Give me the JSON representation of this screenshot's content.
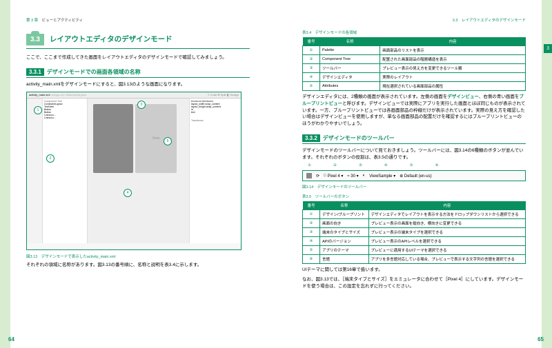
{
  "hdr": {
    "left_ch": "第 3 章",
    "left_t": "ビューとアクティビティ",
    "right": "3.3　レイアウトエディタのデザインモード",
    "tab": "3"
  },
  "sec": {
    "num": "3.3",
    "title": "レイアウトエディタのデザインモード",
    "intro": "ここで、ここまで作成してきた画面をレイアウトエディタのデザインモードで確認してみましょう。"
  },
  "s331": {
    "num": "3.3.1",
    "title": "デザインモードでの画面各領域の名称",
    "p1": "activity_main.xmlをデザインモードにすると、図3.13のような画面になります。",
    "cap": "図3.13　デザインモードで表示したactivity_main.xml",
    "p2": "それぞれの領域に名称があります。図3.13の番号順に、名称と説明を表3.4に示します。"
  },
  "ss": {
    "tabs": [
      "activity_main.xml",
      "strings.xml",
      "MainActivity.java"
    ],
    "tree_h": "Component Tree",
    "tree": [
      "ConstraintLayout",
      "  TextView",
      "  Button",
      "  Button",
      "  LinearLa...",
      "  LinearLa..."
    ],
    "view": "View",
    "attr_h": "Declared Attributes",
    "attr": [
      "layout_width  wrap_content",
      "layout_height  wrap_content",
      "id",
      "text"
    ],
    "trans": "Transforms"
  },
  "t34": {
    "cap": "表3.4　デザインモードの各領域",
    "h": [
      "番号",
      "名称",
      "内容"
    ],
    "r": [
      [
        "①",
        "Palette",
        "画面部品のリストを表示"
      ],
      [
        "②",
        "Component Tree",
        "配置された画面部品の階層構造を表示"
      ],
      [
        "③",
        "ツールバー",
        "プレビュー表示の見え方を変更できるツール類"
      ],
      [
        "④",
        "デザインエディタ",
        "実際のレイアウト"
      ],
      [
        "⑤",
        "Attributes",
        "現在選択されている画面部品の属性"
      ]
    ]
  },
  "rp1": "デザインエディタには、2種類の画面が表示されています。左側の画面を",
  "rp1a": "デザインビュー",
  "rp1b": "、右側の青い画面を",
  "rp1c": "ブループリントビュー",
  "rp1d": "と呼びます。デザインビューでは実際にアプリを実行した画面とほぼ同じものが表示されています。一方、ブループリントビューでは各画面部品の枠線だけが表示されています。実際の見え方を確認したい場合はデザインビューを使用しますが、単なる画面部品の配置だけを確認するにはブループリントビューのほうがわかりやすいでしょう。",
  "s332": {
    "num": "3.3.2",
    "title": "デザインモードのツールバー",
    "p1": "デザインモードのツールバーについて見ておきましょう。ツールバーには、図3.14の6種類のボタンが並んでいます。それぞれのボタンの役割は、表3.5の通りです。",
    "cap": "図3.14　デザインモードのツールバー"
  },
  "tb": {
    "nums": [
      "①",
      "②",
      "③",
      "④",
      "⑤",
      "⑥"
    ],
    "pixel": "Pixel 4 ▾",
    "api": "≈ 30 ▾",
    "theme": "◐",
    "vs": "ViewSample ▾",
    "loc": "⊕ Default (en-us)"
  },
  "t35": {
    "cap": "表3.5　ツールバーのボタン",
    "h": [
      "番号",
      "名称",
      "内容"
    ],
    "r": [
      [
        "①",
        "デザイン/ブループリント",
        "デザインエディタでレイアウトを表示する方法をドロップダウンリストから選択できる"
      ],
      [
        "②",
        "画面の向き",
        "プレビュー表示の画面を縦向き、横向きに変更できる"
      ],
      [
        "③",
        "端末のタイプとサイズ",
        "プレビュー表示の端末タイプを選択できる"
      ],
      [
        "④",
        "APIのバージョン",
        "プレビュー表示のAPIレベルを選択できる"
      ],
      [
        "⑤",
        "アプリのテーマ",
        "プレビューに適用するUIテーマを選択できる"
      ],
      [
        "⑥",
        "言語",
        "アプリを多言語対応している場合、プレビューで表示する文字列の言語を選択できる"
      ]
    ]
  },
  "rp2": "UIテーマに関しては第16章で扱います。",
  "rp3": "なお、図3.13では、［端末タイプとサイズ］をエミュレータに合わせて［Pixel 4］にしています。デザインモードを使う場合は、この設定を忘れずに行ってください。",
  "pg": {
    "l": "64",
    "r": "65"
  }
}
